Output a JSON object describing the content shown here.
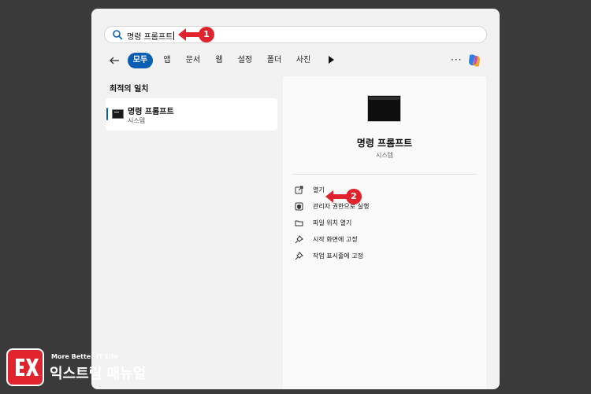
{
  "search": {
    "query": "명령 프롬프트"
  },
  "callouts": {
    "first": "1",
    "second": "2"
  },
  "filters": {
    "items": [
      "모두",
      "앱",
      "문서",
      "웹",
      "설정",
      "폴더",
      "사진"
    ],
    "more": "···"
  },
  "left": {
    "section_title": "최적의 일치",
    "best_match": {
      "name": "명령 프롬프트",
      "type": "시스템"
    }
  },
  "detail": {
    "title": "명령 프롬프트",
    "subtitle": "시스템",
    "actions": [
      {
        "label": "열기",
        "icon": "open-external-icon"
      },
      {
        "label": "관리자 권한으로 실행",
        "icon": "shield-icon"
      },
      {
        "label": "파일 위치 열기",
        "icon": "folder-icon"
      },
      {
        "label": "시작 화면에 고정",
        "icon": "pin-icon"
      },
      {
        "label": "작업 표시줄에 고정",
        "icon": "pin-icon"
      }
    ]
  },
  "watermark": {
    "tagline": "More Better IT Life",
    "name": "익스트림 매뉴얼"
  },
  "colors": {
    "accent": "#0a5fb4",
    "callout": "#e0242d",
    "background": "#3a3a3a",
    "panel": "#f2f2f2"
  }
}
